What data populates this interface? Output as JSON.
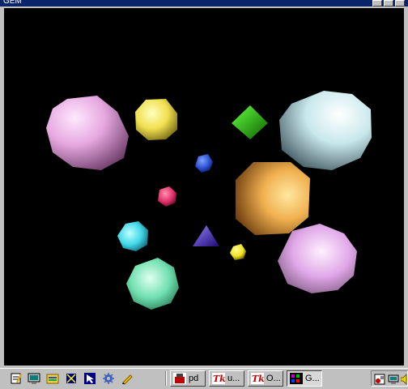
{
  "window": {
    "title": "GEM"
  },
  "taskbar": {
    "quick_launch": [
      {
        "icon": "notepad-icon"
      },
      {
        "icon": "monitor-icon"
      },
      {
        "icon": "folder-icon"
      },
      {
        "icon": "network-icon"
      },
      {
        "icon": "cursor-icon"
      },
      {
        "icon": "gear-icon"
      },
      {
        "icon": "pencil-icon"
      }
    ],
    "tasks": [
      {
        "label": "pd",
        "icon": "pd-icon",
        "active": false
      },
      {
        "label": "u...",
        "icon": "tk-icon",
        "active": false
      },
      {
        "label": "O...",
        "icon": "tk-icon",
        "active": false
      },
      {
        "label": "G...",
        "icon": "gem-icon",
        "active": true
      }
    ]
  },
  "colors": {
    "viewport_bg": "#000000",
    "titlebar": "#0a246a",
    "shapes": {
      "pink": "#e6a8e0",
      "yellow": "#f0e050",
      "green": "#40d020",
      "white_blue": "#c8e8ec",
      "blue": "#2a50d0",
      "magenta": "#e0306a",
      "orange": "#f0b050",
      "cyan": "#40d8e8",
      "violet": "#5030d0",
      "small_yellow": "#f0e020",
      "mint": "#70e0b0",
      "lavender": "#e0a8e8"
    }
  }
}
